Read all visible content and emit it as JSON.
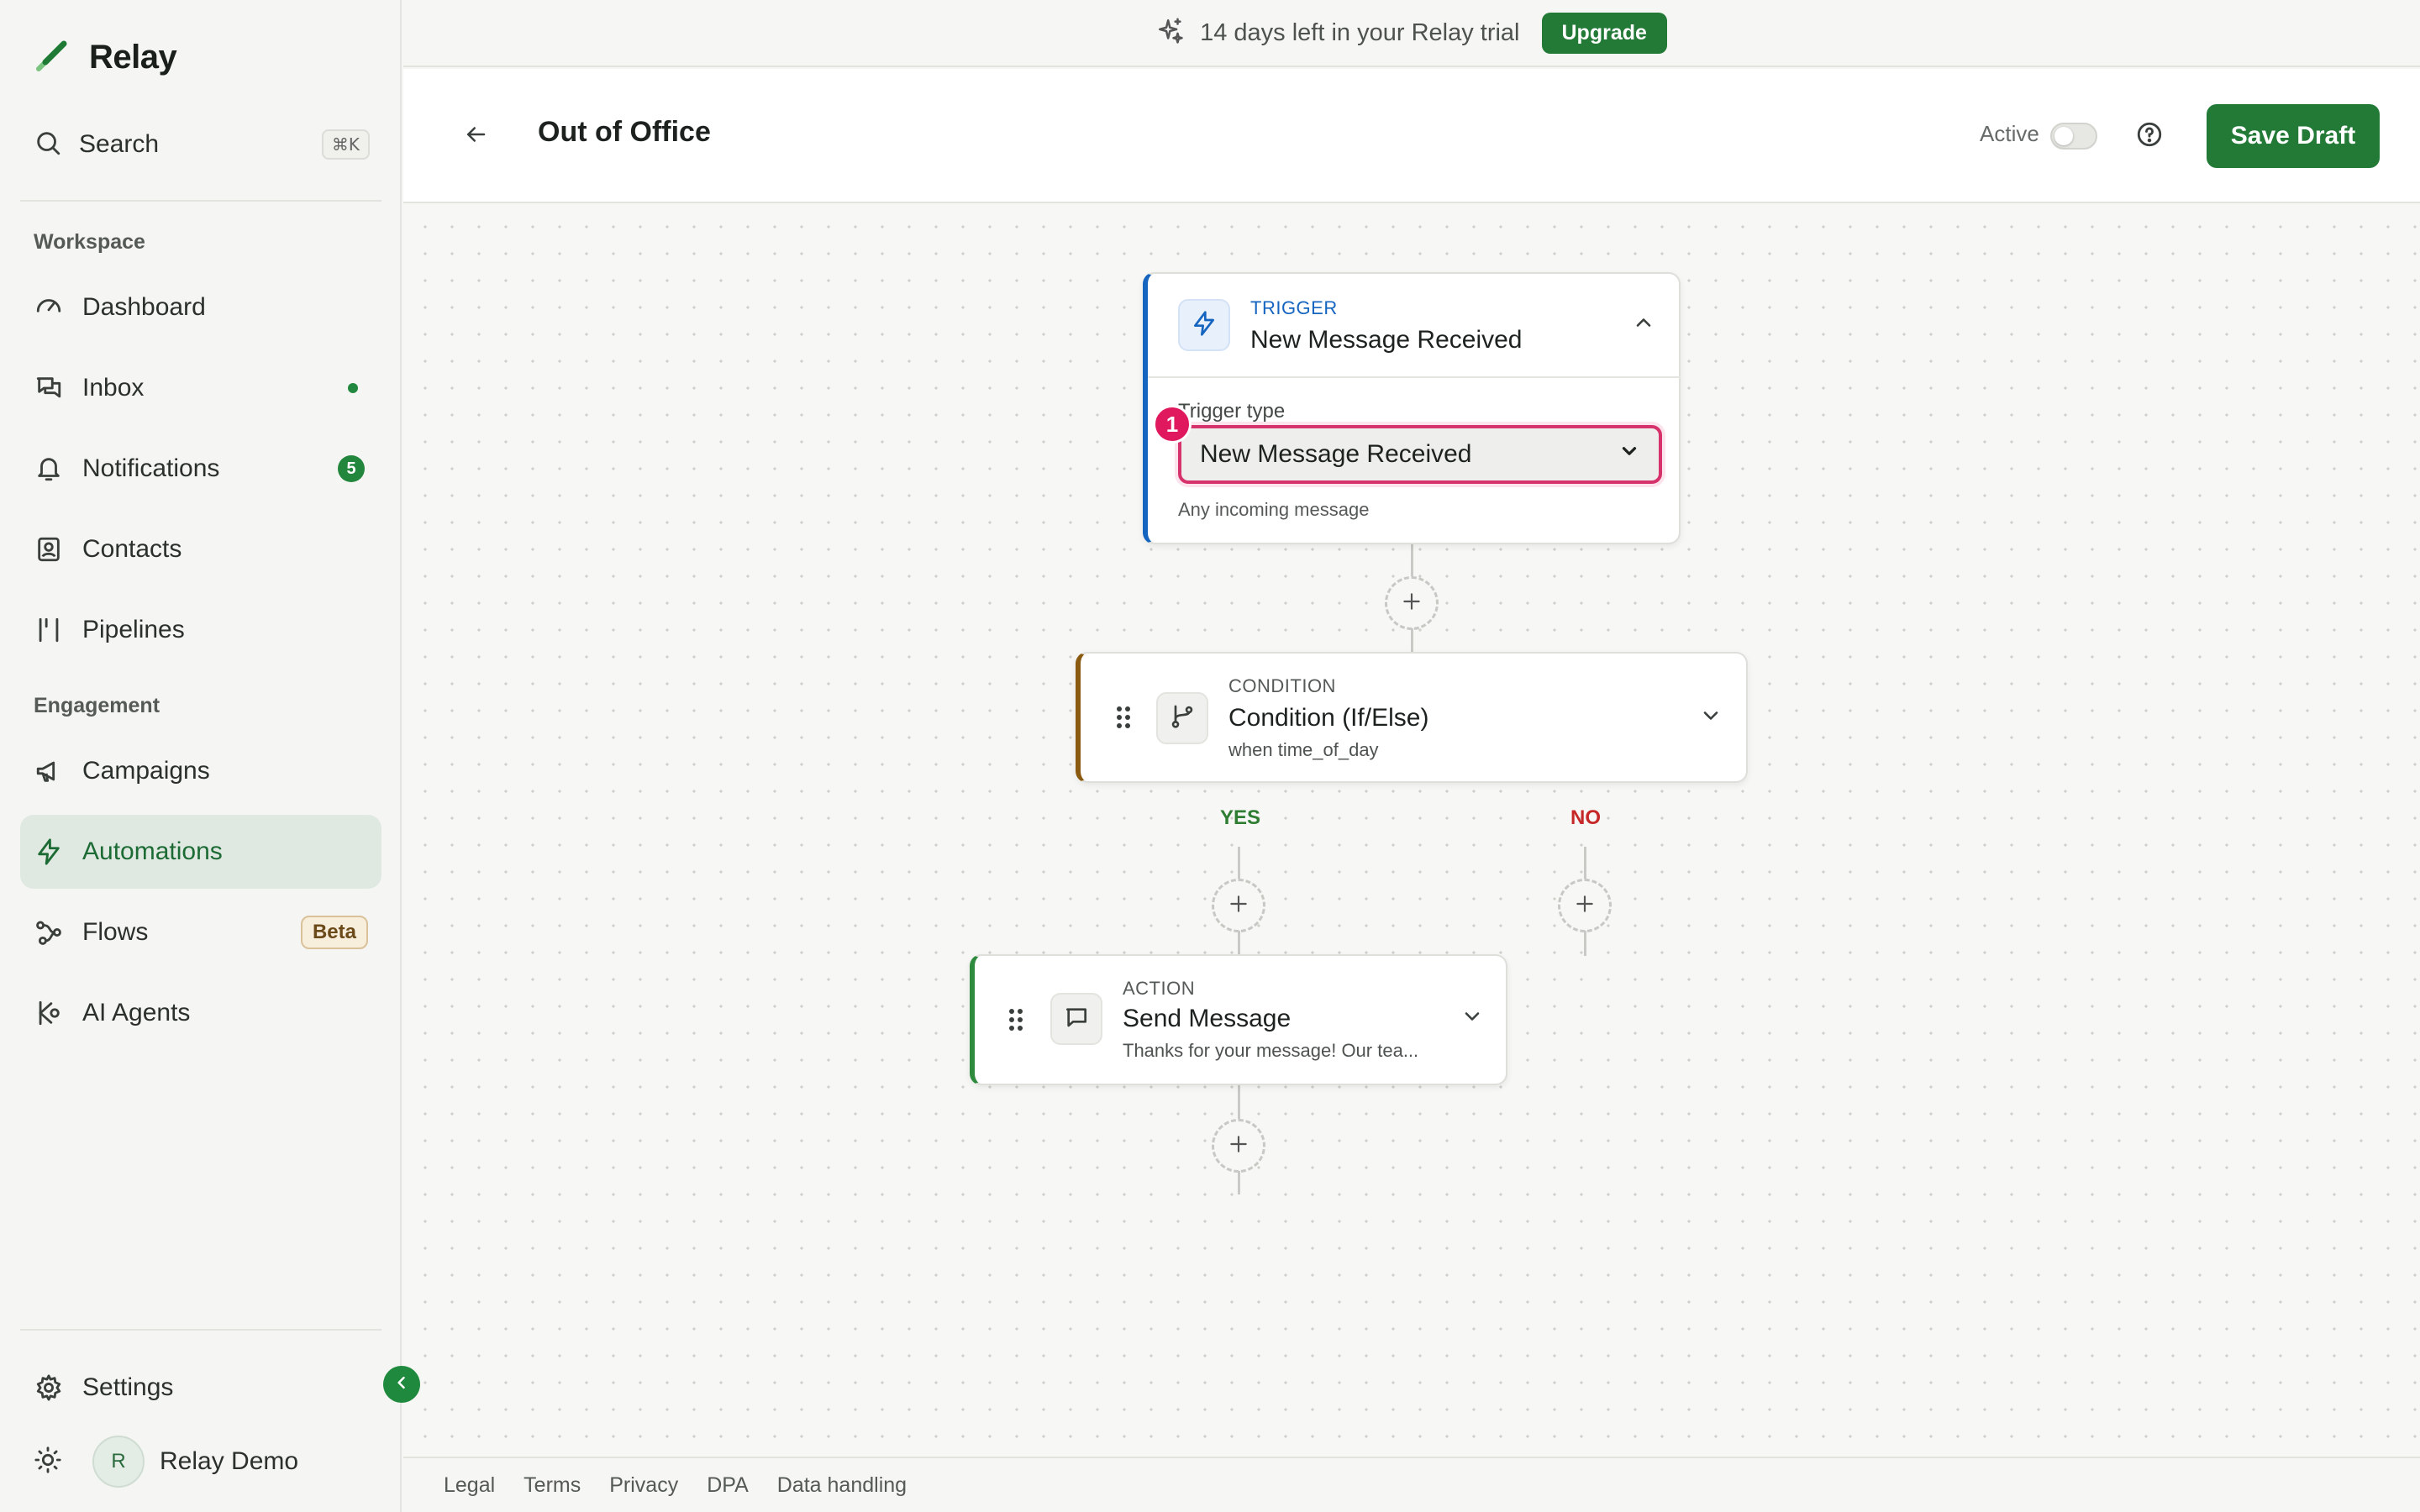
{
  "app": {
    "name": "Relay"
  },
  "colors": {
    "brand": "#237a37",
    "active_bg": "#dfe9e1",
    "trigger": "#1565c0",
    "condition": "#8a5a10",
    "action": "#2e8b3e",
    "highlight": "#d6336c",
    "yes": "#2e7d32",
    "no": "#c62828"
  },
  "banner": {
    "text": "14 days left in your Relay trial",
    "upgrade_label": "Upgrade",
    "icon": "sparkle-icon"
  },
  "sidebar": {
    "search": {
      "label": "Search",
      "shortcut": "⌘K"
    },
    "workspace_title": "Workspace",
    "engagement_title": "Engagement",
    "items": {
      "dashboard": {
        "label": "Dashboard",
        "icon": "gauge-icon"
      },
      "inbox": {
        "label": "Inbox",
        "icon": "chat-icon",
        "unread_dot": true
      },
      "notifications": {
        "label": "Notifications",
        "icon": "bell-icon",
        "count": "5"
      },
      "contacts": {
        "label": "Contacts",
        "icon": "contact-card-icon"
      },
      "pipelines": {
        "label": "Pipelines",
        "icon": "pipeline-icon"
      },
      "campaigns": {
        "label": "Campaigns",
        "icon": "megaphone-icon"
      },
      "automations": {
        "label": "Automations",
        "icon": "bolt-icon",
        "active": true
      },
      "flows": {
        "label": "Flows",
        "icon": "flow-icon",
        "badge": "Beta"
      },
      "ai_agents": {
        "label": "AI Agents",
        "icon": "ai-agent-icon"
      },
      "settings": {
        "label": "Settings",
        "icon": "gear-icon"
      }
    },
    "user": {
      "initial": "R",
      "name": "Relay Demo"
    }
  },
  "header": {
    "title": "Out of Office",
    "active_label": "Active",
    "active": false,
    "save_label": "Save Draft"
  },
  "flow": {
    "trigger": {
      "tag": "TRIGGER",
      "title": "New Message Received",
      "field_label": "Trigger type",
      "selected": "New Message Received",
      "hint": "Any incoming message",
      "marker": "1"
    },
    "condition": {
      "tag": "CONDITION",
      "title": "Condition (If/Else)",
      "subtitle": "when time_of_day",
      "yes_label": "YES",
      "no_label": "NO"
    },
    "action": {
      "tag": "ACTION",
      "title": "Send Message",
      "subtitle": "Thanks for your message! Our tea..."
    }
  },
  "footer": {
    "links": [
      "Legal",
      "Terms",
      "Privacy",
      "DPA",
      "Data handling"
    ]
  }
}
